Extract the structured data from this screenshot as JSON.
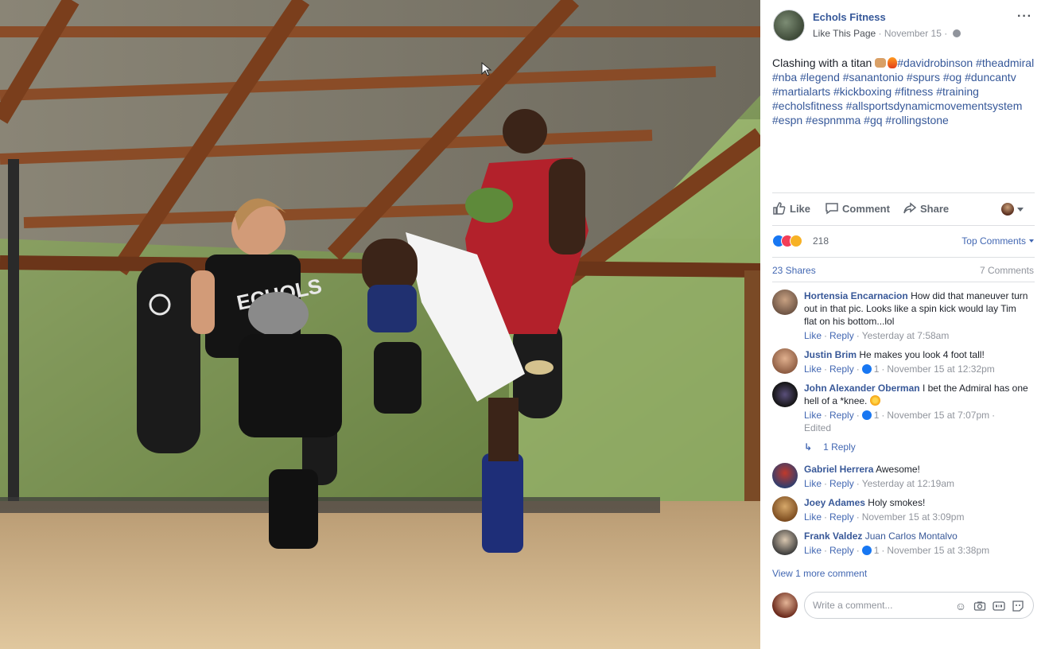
{
  "post": {
    "page_name": "Echols Fitness",
    "like_page": "Like This Page",
    "date": "November 15",
    "date_separator": "·",
    "more_menu": "···",
    "text_intro": "Clashing with a titan",
    "hashtags": "#davidrobinson #theadmiral #nba #legend #sanantonio #spurs #og #duncantv #martialarts #kickboxing #fitness #training #echolsfitness #allsportsdynamicmovementsystem #espn #espnmma #gq #rollingstone"
  },
  "actions": {
    "like": "Like",
    "comment": "Comment",
    "share": "Share"
  },
  "stats": {
    "reaction_count": "218",
    "top_comments": "Top Comments",
    "shares": "23 Shares",
    "comments": "7 Comments"
  },
  "comments": [
    {
      "author": "Hortensia Encarnacion",
      "text": "How did that maneuver turn out in that pic. Looks like a spin kick would lay Tim flat on his bottom...lol",
      "like": "Like",
      "reply": "Reply",
      "likes": "",
      "time": "Yesterday at 7:58am",
      "edited": ""
    },
    {
      "author": "Justin Brim",
      "text": "He makes you look 4 foot tall!",
      "like": "Like",
      "reply": "Reply",
      "likes": "1",
      "time": "November 15 at 12:32pm",
      "edited": ""
    },
    {
      "author": "John Alexander Oberman",
      "text": "I bet the Admiral has one hell of a *knee.",
      "like": "Like",
      "reply": "Reply",
      "likes": "1",
      "time": "November 15 at 7:07pm",
      "edited": "Edited"
    },
    {
      "author": "Gabriel Herrera",
      "text": "Awesome!",
      "like": "Like",
      "reply": "Reply",
      "likes": "",
      "time": "Yesterday at 12:19am",
      "edited": ""
    },
    {
      "author": "Joey Adames",
      "text": "Holy smokes!",
      "like": "Like",
      "reply": "Reply",
      "likes": "",
      "time": "November 15 at 3:09pm",
      "edited": ""
    },
    {
      "author": "Frank Valdez",
      "text": "Juan Carlos Montalvo",
      "like": "Like",
      "reply": "Reply",
      "likes": "1",
      "time": "November 15 at 3:38pm",
      "edited": ""
    }
  ],
  "replies_link": "1 Reply",
  "view_more": "View 1 more comment",
  "write_comment": {
    "placeholder": "Write a comment..."
  },
  "photo": {
    "shirt_text": "ECHOLS"
  },
  "colors": {
    "link_blue": "#365899",
    "facebook_blue": "#4267b2",
    "meta_gray": "#90949c",
    "border": "#dddfe2"
  }
}
